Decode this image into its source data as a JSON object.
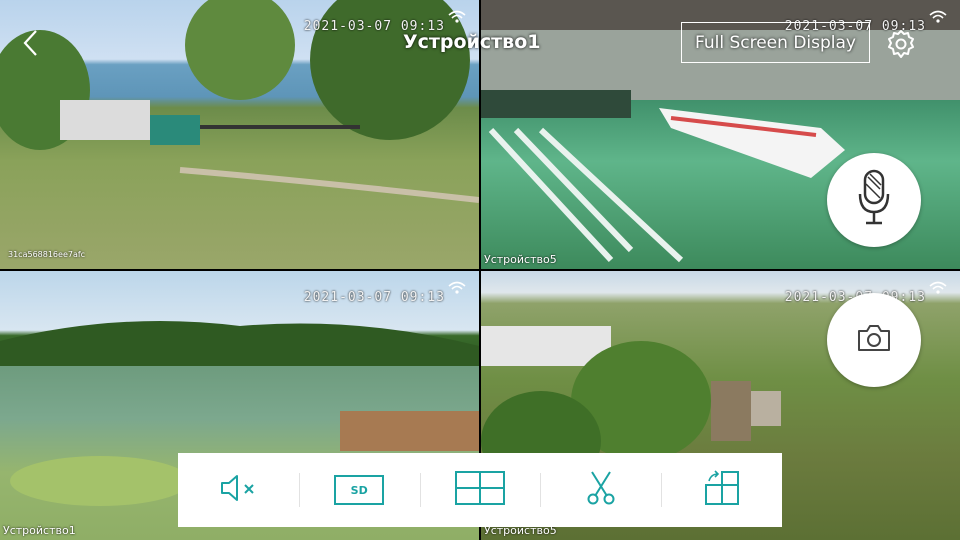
{
  "header": {
    "title": "Устройство1",
    "fullscreen_label": "Full Screen Display",
    "back_icon": "chevron-left-icon",
    "settings_icon": "gear-icon"
  },
  "tiles": [
    {
      "label": "",
      "uid": "31ca568816ee7afc",
      "timestamp": "2021-03-07 09:13"
    },
    {
      "label": "Устройство5",
      "uid": "",
      "timestamp": "2021-03-07 09:13"
    },
    {
      "label": "Устройство1",
      "uid": "",
      "timestamp": "2021-03-07 09:13"
    },
    {
      "label": "Устройство5",
      "uid": "",
      "timestamp": "2021-03-07 09:13"
    }
  ],
  "controls": {
    "mic_icon": "microphone-icon",
    "camera_icon": "camera-icon"
  },
  "toolbar": {
    "mute_icon": "speaker-muted-icon",
    "quality_label": "SD",
    "layout_icon": "grid-layout-icon",
    "clip_icon": "scissors-icon",
    "rotate_icon": "rotate-screen-icon"
  },
  "colors": {
    "accent": "#1aa3a3",
    "toolbar_bg": "#ffffff",
    "overlay_text": "#ffffff"
  }
}
